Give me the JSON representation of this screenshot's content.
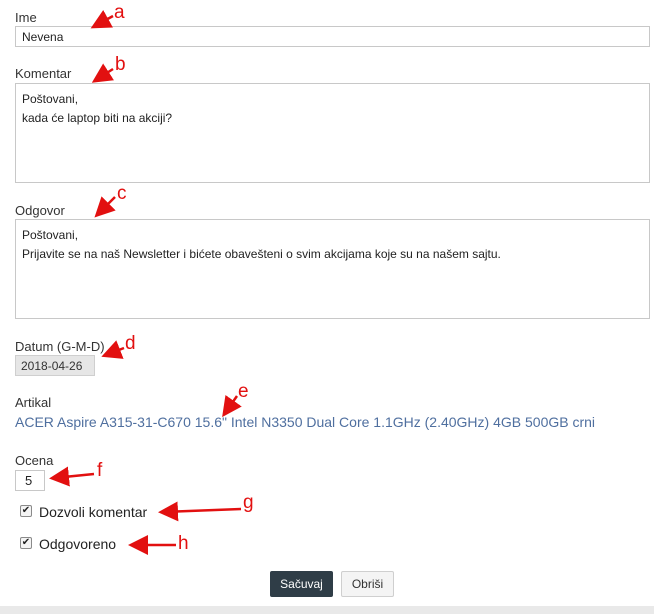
{
  "form": {
    "name": {
      "label": "Ime",
      "value": "Nevena"
    },
    "comment": {
      "label": "Komentar",
      "value": "Poštovani,\nkada će laptop biti na akciji?"
    },
    "reply": {
      "label": "Odgovor",
      "value": "Poštovani,\nPrijavite se na naš Newsletter i bićete obavešteni o svim akcijama koje su na našem sajtu."
    },
    "date": {
      "label": "Datum (G-M-D)",
      "value": "2018-04-26"
    },
    "article": {
      "label": "Artikal",
      "link_text": "ACER Aspire A315-31-C670 15.6\" Intel N3350 Dual Core 1.1GHz (2.40GHz) 4GB 500GB crni"
    },
    "rating": {
      "label": "Ocena",
      "value": "5"
    },
    "allow_comment": {
      "label": "Dozvoli komentar",
      "checked": true
    },
    "answered": {
      "label": "Odgovoreno",
      "checked": true
    },
    "buttons": {
      "save": "Sačuvaj",
      "delete": "Obriši"
    }
  },
  "annotations": {
    "a": "a",
    "b": "b",
    "c": "c",
    "d": "d",
    "e": "e",
    "f": "f",
    "g": "g",
    "h": "h"
  },
  "colors": {
    "annotation": "#e21010",
    "link": "#4f6f9f",
    "primary_button": "#2f3d47"
  }
}
